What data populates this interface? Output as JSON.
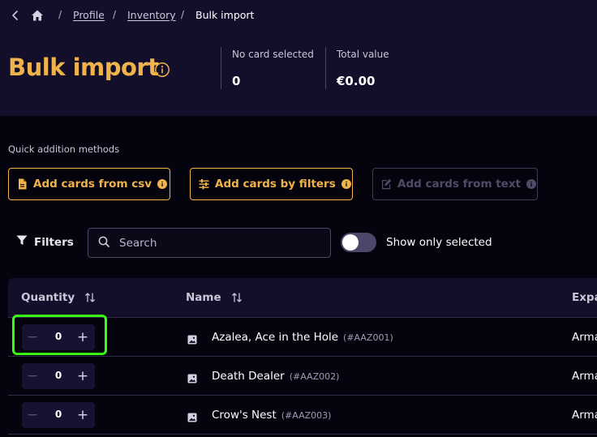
{
  "breadcrumb": {
    "back_icon": "chevron-left-icon",
    "home_icon": "home-icon",
    "separator": "/",
    "items": [
      {
        "label": "Profile"
      },
      {
        "label": "Inventory"
      }
    ],
    "current": "Bulk import"
  },
  "header": {
    "title": "Bulk import",
    "title_icon": "info-icon",
    "stats": [
      {
        "label": "No card selected",
        "value": "0"
      },
      {
        "label": "Total value",
        "value": "€0.00"
      }
    ]
  },
  "quick_add": {
    "label": "Quick addition methods",
    "buttons": [
      {
        "label": "Add cards from csv",
        "icon": "file-icon",
        "enabled": true
      },
      {
        "label": "Add cards by filters",
        "icon": "sliders-icon",
        "enabled": true
      },
      {
        "label": "Add cards from text",
        "icon": "pencil-icon",
        "enabled": false
      }
    ]
  },
  "toolbar": {
    "filters_label": "Filters",
    "search_placeholder": "Search",
    "toggle_label": "Show only selected",
    "toggle_on": false
  },
  "table": {
    "columns": [
      {
        "label": "Quantity",
        "sortable": true
      },
      {
        "label": "Name",
        "sortable": true
      },
      {
        "label": "Expa"
      }
    ],
    "rows": [
      {
        "quantity": "0",
        "name": "Azalea, Ace in the Hole",
        "code": "(#AAZ001)",
        "expansion": "Arma"
      },
      {
        "quantity": "0",
        "name": "Death Dealer",
        "code": "(#AAZ002)",
        "expansion": "Arma"
      },
      {
        "quantity": "0",
        "name": "Crow's Nest",
        "code": "(#AAZ003)",
        "expansion": "Arma"
      }
    ]
  },
  "colors": {
    "accent": "#f0b24a",
    "header_bg": "#130f2b",
    "page_bg": "#05040e",
    "highlight": "#39ff14"
  }
}
